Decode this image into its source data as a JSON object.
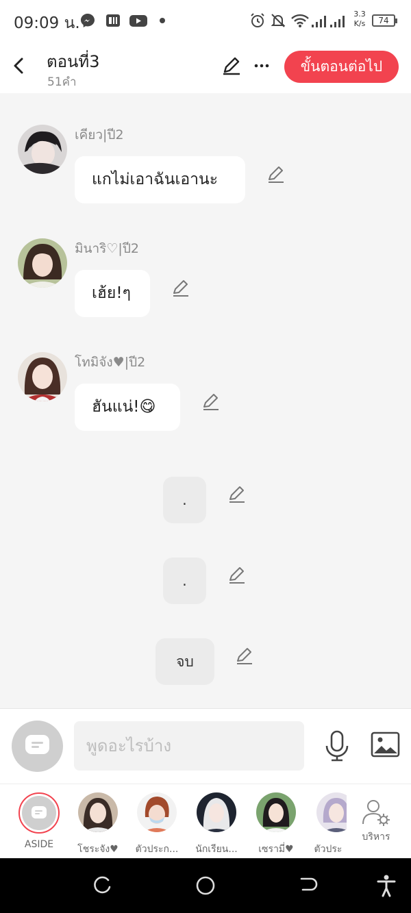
{
  "status_bar": {
    "time": "09:09 น.",
    "net_speed_value": "3.3",
    "net_speed_unit": "K/s",
    "battery": "74",
    "apps": [
      "messenger-icon",
      "pocket-app-icon",
      "youtube-icon"
    ],
    "right_icons": [
      "alarm-icon",
      "notifications-muted-icon",
      "wifi-icon",
      "signal-icon"
    ]
  },
  "header": {
    "title": "ตอนที่3",
    "subtitle": "51คำ",
    "next_label": "ขั้นตอนต่อไป",
    "accent": "#f2434f"
  },
  "messages": [
    {
      "sender": "เคียว|ปี2",
      "text": "แกไม่เอาฉันเอานะ"
    },
    {
      "sender": "มินาริ♡|ปี2",
      "text": "เฮ้ย!ๆ"
    },
    {
      "sender": "โทมิจัง♥|ปี2",
      "text": "ฮันแน่!😋"
    }
  ],
  "narration": [
    {
      "text": "."
    },
    {
      "text": "."
    },
    {
      "text": "จบ"
    }
  ],
  "composer": {
    "placeholder": "พูดอะไรบ้าง"
  },
  "characters": [
    {
      "name": "ASIDE"
    },
    {
      "name": "โชระจัง♥"
    },
    {
      "name": "ตัวประก..."
    },
    {
      "name": "นักเรียน..."
    },
    {
      "name": "เซรามี่♥"
    },
    {
      "name": "ตัวประ"
    },
    {
      "name": "บริหาร"
    }
  ],
  "nav": [
    "recents-button",
    "home-button",
    "back-button",
    "accessibility-button"
  ]
}
